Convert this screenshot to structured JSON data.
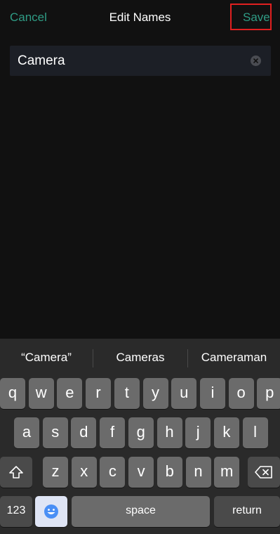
{
  "nav": {
    "cancel_label": "Cancel",
    "title": "Edit Names",
    "save_label": "Save"
  },
  "field": {
    "value": "Camera"
  },
  "keyboard": {
    "suggestions": [
      "“Camera”",
      "Cameras",
      "Cameraman"
    ],
    "row1": [
      "q",
      "w",
      "e",
      "r",
      "t",
      "y",
      "u",
      "i",
      "o",
      "p"
    ],
    "row2": [
      "a",
      "s",
      "d",
      "f",
      "g",
      "h",
      "j",
      "k",
      "l"
    ],
    "row3": [
      "z",
      "x",
      "c",
      "v",
      "b",
      "n",
      "m"
    ],
    "numbers_label": "123",
    "space_label": "space",
    "return_label": "return"
  },
  "colors": {
    "accent": "#2f9c85",
    "highlight_border": "#e02020",
    "background": "#111111",
    "keyboard_bg": "#2a2a2a",
    "key": "#6b6b6b",
    "key_dark": "#4a4a4a"
  }
}
